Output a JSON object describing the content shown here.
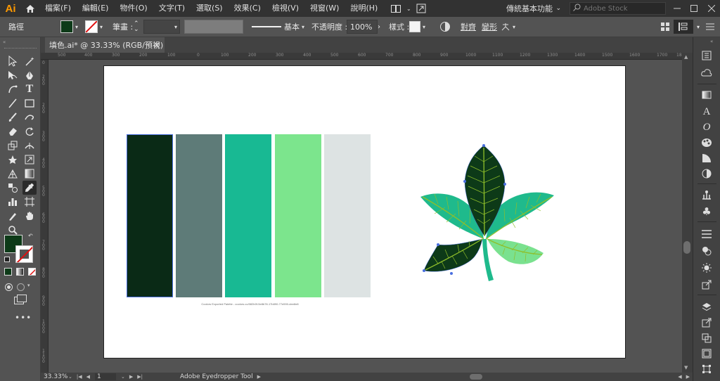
{
  "app": {
    "logo": "Ai"
  },
  "menu": [
    "檔案(F)",
    "編輯(E)",
    "物件(O)",
    "文字(T)",
    "選取(S)",
    "效果(C)",
    "檢視(V)",
    "視窗(W)",
    "說明(H)"
  ],
  "workspace": {
    "label": "傳統基本功能"
  },
  "stock_search": {
    "placeholder": "Adobe Stock"
  },
  "controlbar": {
    "selection_label": "路徑",
    "stroke_label": "筆畫 :",
    "stroke_style_label": "基本",
    "opacity_label": "不透明度 :",
    "opacity_value": "100%",
    "style_label": "樣式 :",
    "align_label": "對齊",
    "transform_label": "變形"
  },
  "document": {
    "tab_title": "填色.ai* @ 33.33% (RGB/預視)",
    "close_glyph": "×"
  },
  "ruler": {
    "top_labels": [
      "500",
      "400",
      "300",
      "200",
      "100",
      "0",
      "100",
      "200",
      "300",
      "400",
      "500",
      "600",
      "700",
      "800",
      "900",
      "1000",
      "1100",
      "1200",
      "1300",
      "1400",
      "1500",
      "1600",
      "1700",
      "1800"
    ],
    "left_labels": [
      "0",
      "2 0 0",
      "2 0 0",
      "3 0 0",
      "4 0 0",
      "5 0 0",
      "6 0 0",
      "7 0 0",
      "8 0 0",
      "9 0 0",
      "1 0 0 0",
      "1 1 0 0"
    ]
  },
  "palette": {
    "colors": [
      "#0a2a16",
      "#5e7b78",
      "#18b993",
      "#7ce58d",
      "#dde3e3"
    ],
    "caption": "Coolors Exported Palette - coolors.co/082b0f-5e8b78-17b890-77e590-dee8e8"
  },
  "leaf": {
    "colors": {
      "dark": "#0d3a18",
      "teal": "#1fba8c",
      "light": "#7ae18f",
      "vein": "#8fbf2a",
      "stem": "#1fba8c"
    }
  },
  "colors": {
    "fill_swatch": "#0d3a18",
    "accent_orange": "#ff9a00",
    "selection_blue": "#4a6fe0"
  },
  "statusbar": {
    "zoom": "33.33%",
    "artboard_number": "1",
    "tool": "Adobe Eyedropper Tool"
  },
  "icons": [
    "home-icon",
    "arrange-docs-icon",
    "gpu-icon",
    "search-icon",
    "minimize-icon",
    "maximize-icon",
    "close-icon",
    "eyedropper-icon"
  ]
}
